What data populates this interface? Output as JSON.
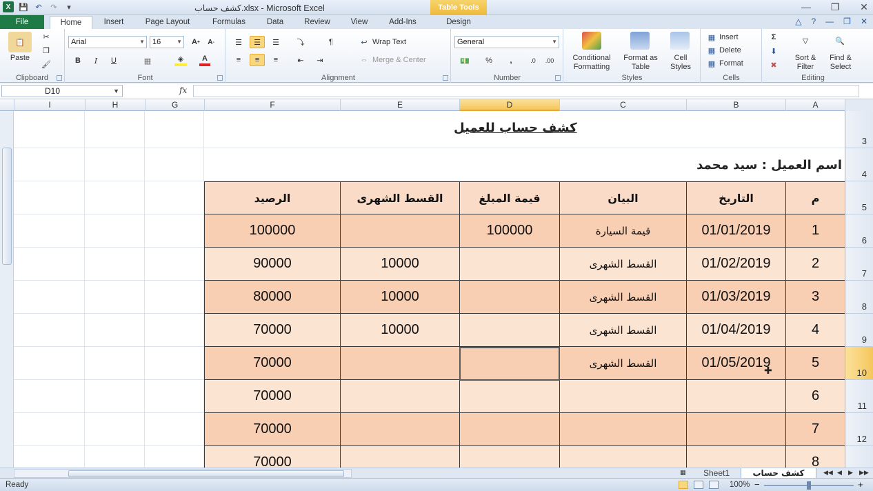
{
  "window": {
    "title": "كشف حساب.xlsx - Microsoft Excel",
    "contextual_tab_group": "Table Tools"
  },
  "ribbon_tabs": [
    "File",
    "Home",
    "Insert",
    "Page Layout",
    "Formulas",
    "Data",
    "Review",
    "View",
    "Add-Ins",
    "Design"
  ],
  "active_tab": "Home",
  "ribbon": {
    "clipboard": {
      "label": "Clipboard",
      "paste": "Paste"
    },
    "font": {
      "label": "Font",
      "font_name": "Arial",
      "font_size": "16",
      "bold": "B",
      "italic": "I",
      "underline": "U"
    },
    "alignment": {
      "label": "Alignment",
      "wrap_text": "Wrap Text",
      "merge_center": "Merge & Center"
    },
    "number": {
      "label": "Number",
      "format": "General",
      "percent": "%",
      "comma": ","
    },
    "styles": {
      "label": "Styles",
      "conditional": "Conditional",
      "conditional2": "Formatting",
      "format_as": "Format as",
      "format_as2": "Table",
      "cell": "Cell",
      "cell2": "Styles"
    },
    "cells": {
      "label": "Cells",
      "insert": "Insert",
      "delete": "Delete",
      "format": "Format"
    },
    "editing": {
      "label": "Editing",
      "sort": "Sort &",
      "sort2": "Filter",
      "find": "Find &",
      "find2": "Select"
    }
  },
  "formula_bar": {
    "name_box": "D10",
    "fx": "fx",
    "content": ""
  },
  "columns": [
    "I",
    "H",
    "G",
    "F",
    "E",
    "D",
    "C",
    "B",
    "A"
  ],
  "selected_column": "D",
  "rows": [
    "3",
    "4",
    "5",
    "6",
    "7",
    "8",
    "9",
    "10",
    "11",
    "12"
  ],
  "selected_row": "10",
  "sheet": {
    "title": "كشف حساب للعميل",
    "client_line": "اسم العميل : سيد محمد",
    "headers": {
      "num": "م",
      "date": "التاريخ",
      "desc": "البيان",
      "amount": "قيمة المبلغ",
      "installment": "القسط الشهرى",
      "balance": "الرصيد"
    },
    "data_rows": [
      {
        "num": "1",
        "date": "01/01/2019",
        "desc": "قيمة السيارة",
        "amount": "100000",
        "installment": "",
        "balance": "100000"
      },
      {
        "num": "2",
        "date": "01/02/2019",
        "desc": "القسط الشهرى",
        "amount": "",
        "installment": "10000",
        "balance": "90000"
      },
      {
        "num": "3",
        "date": "01/03/2019",
        "desc": "القسط الشهرى",
        "amount": "",
        "installment": "10000",
        "balance": "80000"
      },
      {
        "num": "4",
        "date": "01/04/2019",
        "desc": "القسط الشهرى",
        "amount": "",
        "installment": "10000",
        "balance": "70000"
      },
      {
        "num": "5",
        "date": "01/05/2019",
        "desc": "القسط الشهرى",
        "amount": "",
        "installment": "",
        "balance": "70000"
      },
      {
        "num": "6",
        "date": "",
        "desc": "",
        "amount": "",
        "installment": "",
        "balance": "70000"
      },
      {
        "num": "7",
        "date": "",
        "desc": "",
        "amount": "",
        "installment": "",
        "balance": "70000"
      },
      {
        "num": "8",
        "date": "",
        "desc": "",
        "amount": "",
        "installment": "",
        "balance": "70000"
      }
    ]
  },
  "sheet_tabs": {
    "inactive": "Sheet1",
    "active": "كشف حساب"
  },
  "status": {
    "ready": "Ready",
    "zoom": "100%"
  },
  "colors": {
    "header_fill": "#fadbc7",
    "row_light": "#fce4d3",
    "row_dark": "#f9cfb3",
    "selection": "#f4c65a",
    "file_tab": "#1f7b46"
  }
}
